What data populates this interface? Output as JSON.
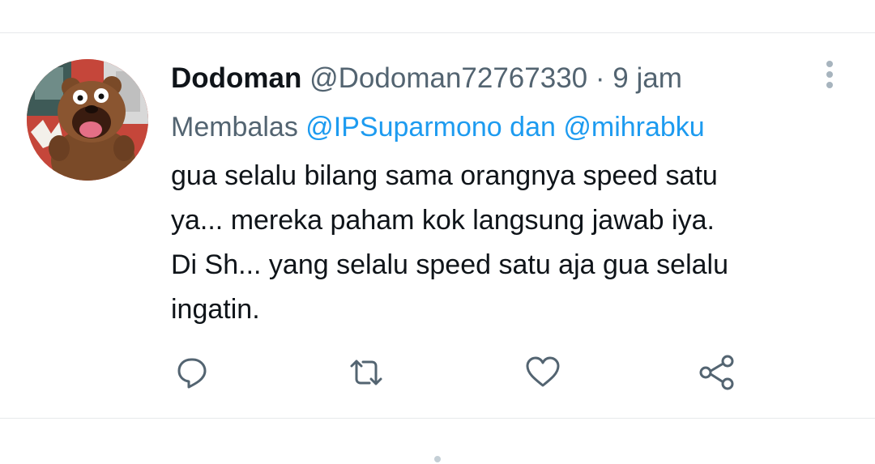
{
  "tweet": {
    "author": {
      "display_name": "Dodoman",
      "handle": "@Dodoman72767330",
      "avatar": "grizzly-bear-cartoon"
    },
    "separator": "·",
    "time": "9 jam",
    "reply": {
      "prefix": "Membalas",
      "mention_1": "@IPSuparmono",
      "conjunction": "dan",
      "mention_2": "@mihrabku"
    },
    "text_lines": [
      "gua selalu bilang sama orangnya speed satu",
      "ya... mereka paham kok langsung jawab iya.",
      "Di Sh... yang selalu speed satu aja gua selalu",
      "ingatin."
    ],
    "actions": [
      {
        "name": "reply",
        "icon": "comment-icon"
      },
      {
        "name": "retweet",
        "icon": "retweet-icon"
      },
      {
        "name": "like",
        "icon": "heart-icon"
      },
      {
        "name": "share",
        "icon": "share-icon"
      }
    ]
  },
  "colors": {
    "text_primary": "#0f1419",
    "text_secondary": "#536471",
    "link": "#1d9bf0",
    "icon": "#536471",
    "divider": "#e6e9eb"
  }
}
